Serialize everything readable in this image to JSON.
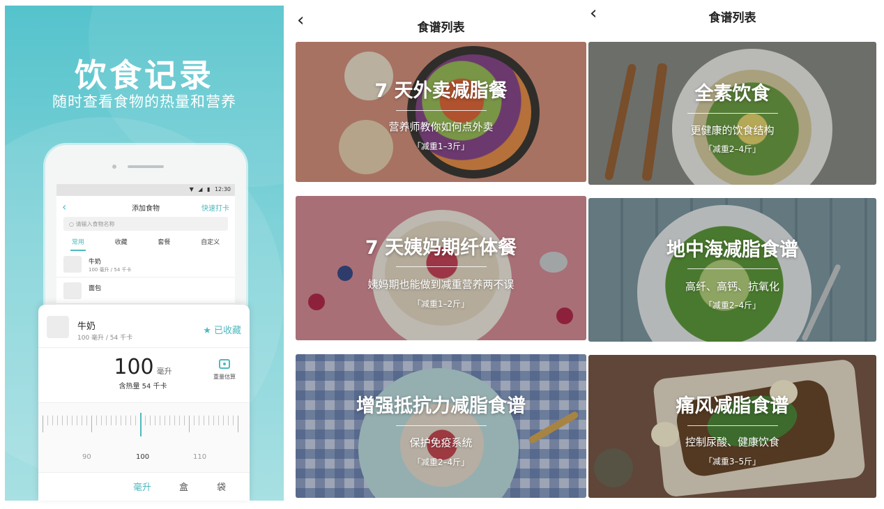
{
  "promo": {
    "title": "饮食记录",
    "subtitle": "随时查看食物的热量和营养",
    "phone": {
      "status_time": "12:30",
      "nav_title": "添加食物",
      "nav_action": "快速打卡",
      "search_placeholder": "请输入食物名称",
      "tabs": [
        "常用",
        "收藏",
        "套餐",
        "自定义"
      ],
      "foods": [
        {
          "name": "牛奶",
          "desc": "100 毫升 / 54 千卡"
        },
        {
          "name": "面包",
          "desc": ""
        }
      ]
    },
    "sheet": {
      "food_name": "牛奶",
      "food_desc": "100 毫升 / 54 千卡",
      "fav_label": "已收藏",
      "amount": "100",
      "amount_unit": "毫升",
      "calories": "含热量 54 千卡",
      "scale_label": "重量估算",
      "ruler_labels": [
        "90",
        "100",
        "110"
      ],
      "units": [
        "毫升",
        "盒",
        "袋"
      ],
      "active_unit": "毫升"
    }
  },
  "list_left": {
    "title": "食谱列表",
    "cards": [
      {
        "title": "7 天外卖减脂餐",
        "subtitle": "营养师教你如何点外卖",
        "badge": "「减重1–3斤」"
      },
      {
        "title": "7 天姨妈期纤体餐",
        "subtitle": "姨妈期也能做到减重营养两不误",
        "badge": "「减重1–2斤」"
      },
      {
        "title": "增强抵抗力减脂食谱",
        "subtitle": "保护免疫系统",
        "badge": "「减重2–4斤」"
      }
    ]
  },
  "list_right": {
    "title": "食谱列表",
    "cards": [
      {
        "title": "全素饮食",
        "subtitle": "更健康的饮食结构",
        "badge": "「减重2–4斤」"
      },
      {
        "title": "地中海减脂食谱",
        "subtitle": "高纤、高钙、抗氧化",
        "badge": "「减重2–4斤」"
      },
      {
        "title": "痛风减脂食谱",
        "subtitle": "控制尿酸、健康饮食",
        "badge": "「减重3–5斤」"
      }
    ]
  },
  "colors": {
    "accent": "#4fb8bf",
    "promo_bg": "#55c3cc"
  },
  "icons": [
    "back-chevron-icon",
    "wifi-icon",
    "signal-icon",
    "battery-icon",
    "search-icon",
    "star-icon",
    "scale-icon"
  ]
}
